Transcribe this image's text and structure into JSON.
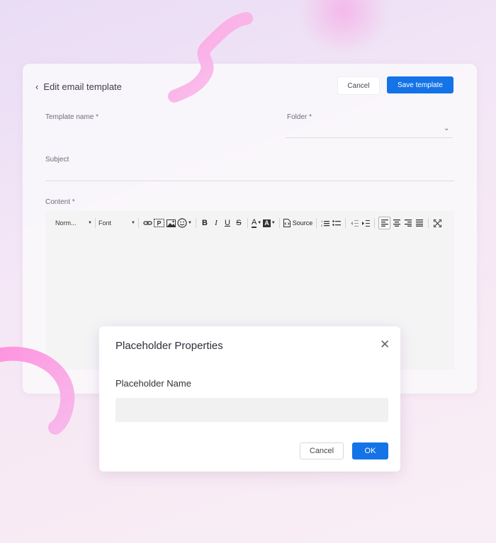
{
  "header": {
    "back_icon": "chevron-left-icon",
    "title": "Edit email template",
    "cancel_label": "Cancel",
    "save_label": "Save template"
  },
  "form": {
    "template_name_label": "Template name *",
    "template_name_value": "",
    "folder_label": "Folder *",
    "folder_value": "",
    "subject_label": "Subject",
    "subject_value": "",
    "content_label": "Content *"
  },
  "toolbar": {
    "format_combo": "Norm...",
    "font_combo": "Font",
    "source_label": "Source",
    "icons": [
      "link-icon",
      "placeholder-icon",
      "image-icon",
      "emoji-icon",
      "bold-icon",
      "italic-icon",
      "underline-icon",
      "strikethrough-icon",
      "text-color-icon",
      "background-color-icon",
      "source-icon",
      "numbered-list-icon",
      "bulleted-list-icon",
      "outdent-icon",
      "indent-icon",
      "align-left-icon",
      "align-center-icon",
      "align-right-icon",
      "justify-icon",
      "maximize-icon"
    ],
    "active_alignment": "left"
  },
  "dialog": {
    "title": "Placeholder Properties",
    "close_icon": "close-icon",
    "name_label": "Placeholder Name",
    "name_value": "",
    "cancel_label": "Cancel",
    "ok_label": "OK"
  },
  "colors": {
    "primary": "#1473e6",
    "background_pink": "#f6e6f4",
    "decor_pink": "#f6a6de"
  }
}
